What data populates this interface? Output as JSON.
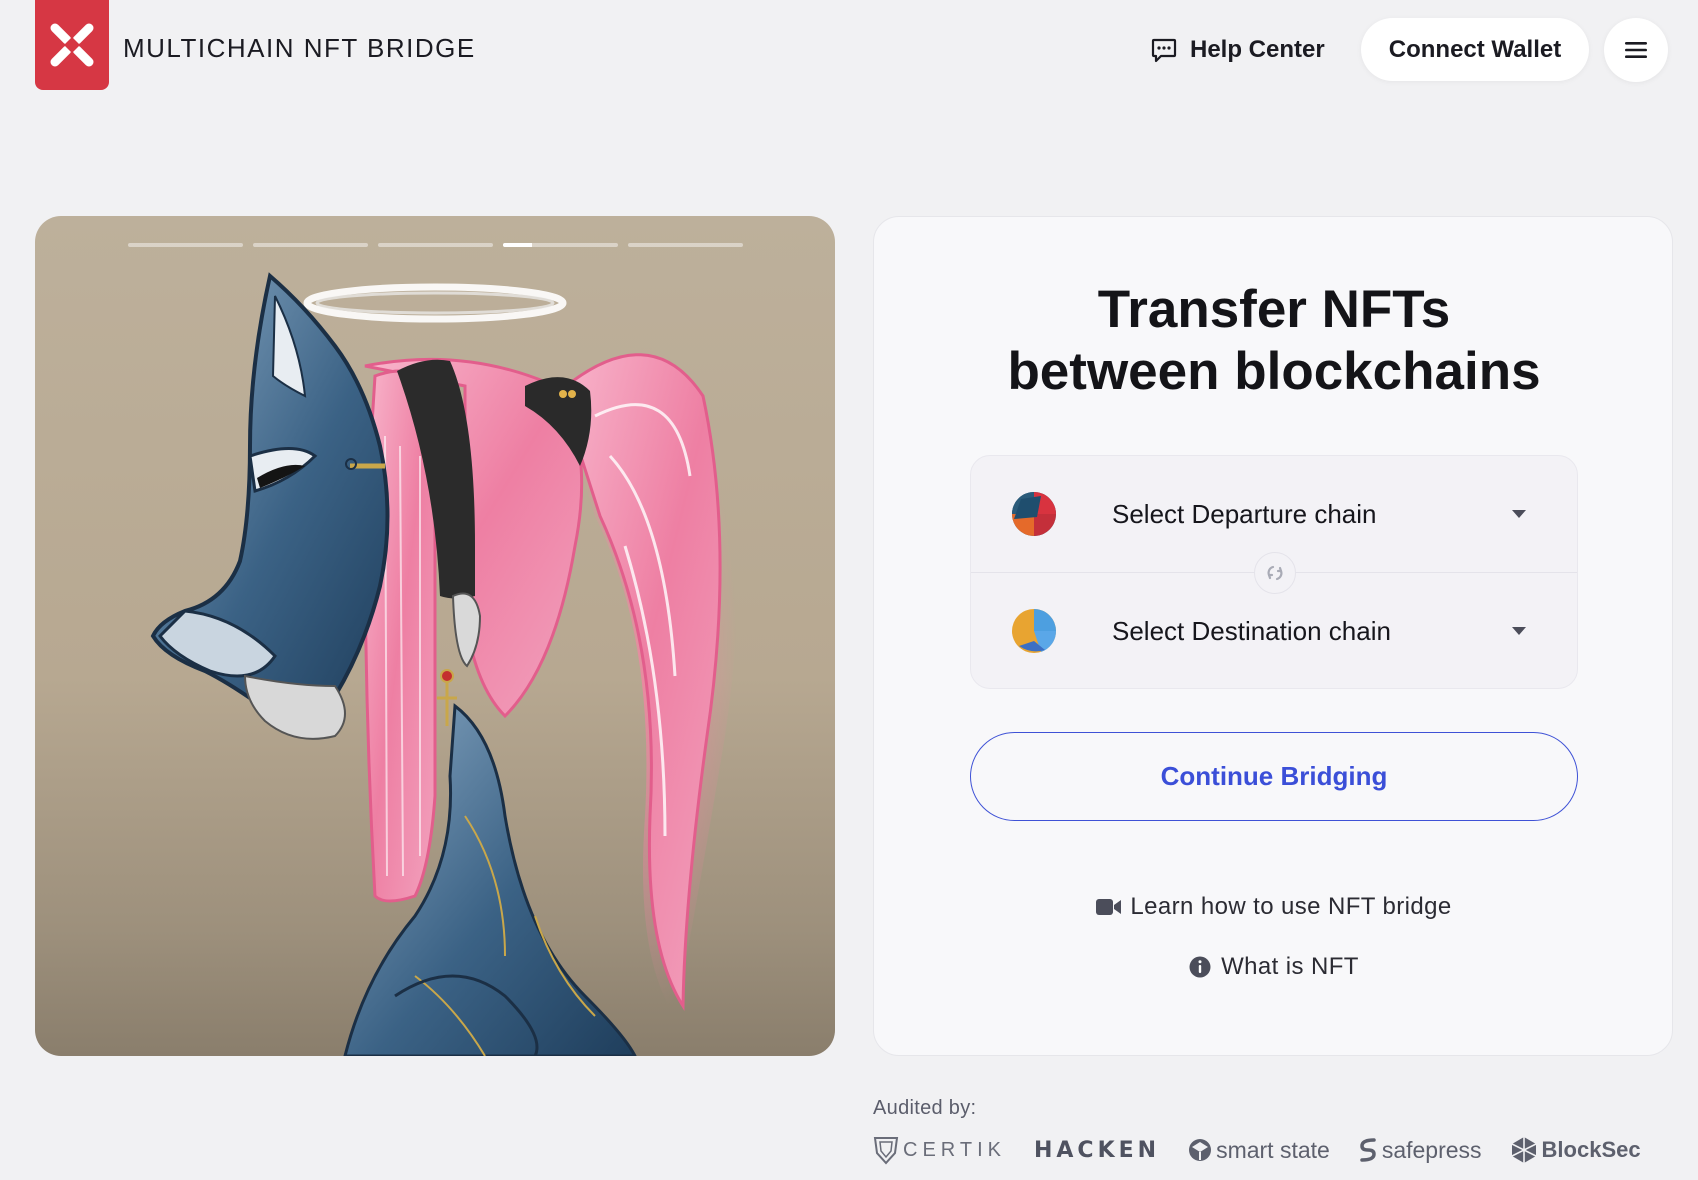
{
  "header": {
    "brand_name": "MULTICHAIN NFT BRIDGE",
    "help_center_label": "Help Center",
    "connect_wallet_label": "Connect Wallet",
    "menu_icon": "hamburger-icon",
    "logo_icon": "xp-logo-icon",
    "brand_color": "#d63744"
  },
  "carousel": {
    "slide_count": 5,
    "active_index": 3,
    "active_progress": 0.25,
    "image_subject": "nft-artwork-fox-masked-cyborg"
  },
  "transfer_card": {
    "title_line1": "Transfer NFTs",
    "title_line2": "between blockchains",
    "departure_label": "Select Departure chain",
    "destination_label": "Select Destination chain",
    "swap_icon": "swap-arrows-icon",
    "continue_label": "Continue Bridging",
    "learn_link": "Learn how to use NFT bridge",
    "learn_icon": "video-camera-icon",
    "what_link": "What is NFT",
    "what_icon": "info-icon",
    "accent_color": "#3b4fd8"
  },
  "audited": {
    "label": "Audited by:",
    "auditors": [
      "CERTIK",
      "HACKEN",
      "smart state",
      "safepress",
      "BlockSec"
    ]
  }
}
